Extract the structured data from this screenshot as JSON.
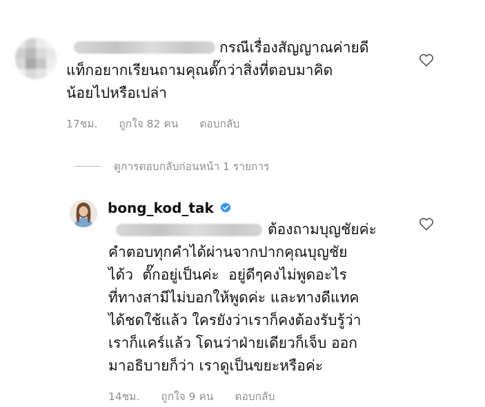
{
  "comment": {
    "first_line": "กรณีเรื่องสัญญาณค่ายดี",
    "rest": "แท็กอยากเรียนถามคุณตั๊กว่าสิ่งที่ตอบมาคิด\nน้อยไปหรือเปล่า",
    "time": "17ชม.",
    "likes": "ถูกใจ 82 คน",
    "reply": "ตอบกลับ"
  },
  "view_previous_replies": "ดูการตอบกลับก่อนหน้า 1 รายการ",
  "reply_comment": {
    "username": "bong_kod_tak",
    "first_line": "ต้องถามบุญชัยค่ะ",
    "rest": "คำตอบทุกคำได้ผ่านจากปากคุณบุญชัย\nได้ว  ตั๊กอยู่เป็นค่ะ  อยู่ดีๆคงไม่พูดอะไร\nที่ทางสามีไม่บอกให้พูดค่ะ และทางดีแทค\nได้ชดใช้แล้ว ใครยังว่าเราก็คงต้องรับรู้ว่า\nเราก็แคร์แล้ว โดนว่าฝ่ายเดียวก็เจ็บ ออก\nมาอธิบายก็ว่า เราดูเป็นขยะหรือค่ะ",
    "time": "14ชม.",
    "likes": "ถูกใจ 9 คน",
    "reply": "ตอบกลับ"
  },
  "icons": {
    "like": "heart-outline-icon",
    "verified": "verified-badge-icon"
  },
  "colors": {
    "text": "#111111",
    "meta": "#8e8e8e",
    "verified": "#3897f0"
  }
}
